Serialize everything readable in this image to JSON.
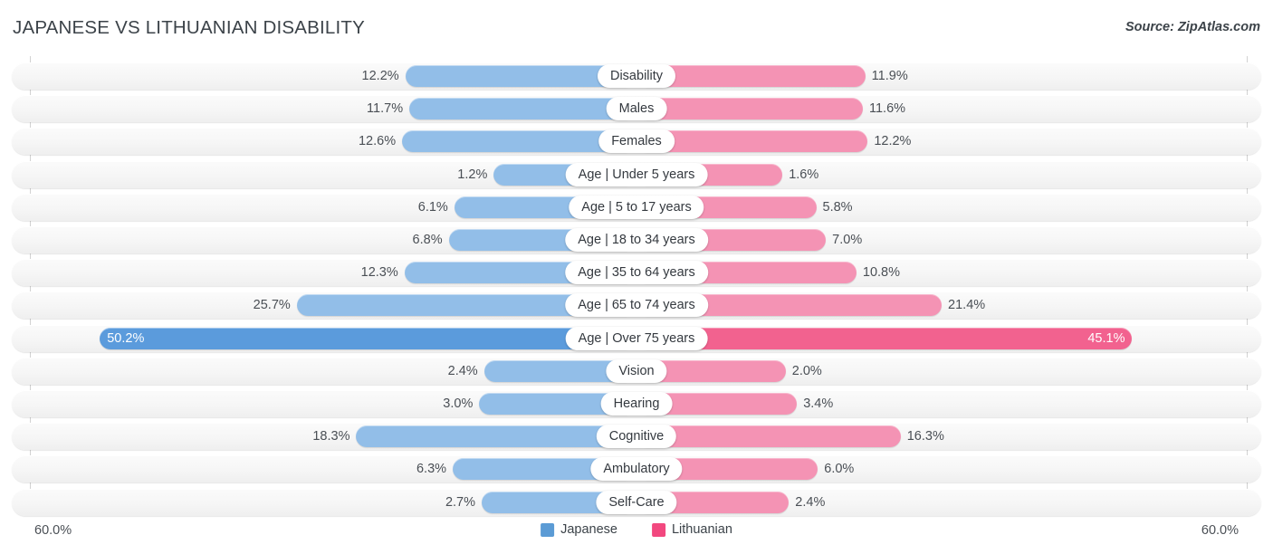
{
  "header": {
    "title": "JAPANESE VS LITHUANIAN DISABILITY",
    "source": "Source: ZipAtlas.com"
  },
  "axis": {
    "left_label": "60.0%",
    "right_label": "60.0%",
    "max": 60.0
  },
  "legend": {
    "items": [
      {
        "label": "Japanese",
        "color": "#5b9bd5"
      },
      {
        "label": "Lithuanian",
        "color": "#f2487f"
      }
    ]
  },
  "colors": {
    "left_bar": "#92bee8",
    "right_bar": "#f493b4",
    "left_bar_highlight": "#5b9bdc",
    "right_bar_highlight": "#f2628f",
    "row_track": "#f6f6f6"
  },
  "chart_data": {
    "type": "bar",
    "title": "JAPANESE VS LITHUANIAN DISABILITY",
    "subtitle": "Source: ZipAtlas.com",
    "orientation": "horizontal-diverging",
    "xlabel": "",
    "ylabel": "",
    "xlim": [
      60.0,
      60.0
    ],
    "grid": false,
    "legend_position": "bottom-center",
    "categories": [
      "Disability",
      "Males",
      "Females",
      "Age | Under 5 years",
      "Age | 5 to 17 years",
      "Age | 18 to 34 years",
      "Age | 35 to 64 years",
      "Age | 65 to 74 years",
      "Age | Over 75 years",
      "Vision",
      "Hearing",
      "Cognitive",
      "Ambulatory",
      "Self-Care"
    ],
    "series": [
      {
        "name": "Japanese",
        "color": "#5b9bd5",
        "values": [
          12.2,
          11.7,
          12.6,
          1.2,
          6.1,
          6.8,
          12.3,
          25.7,
          50.2,
          2.4,
          3.0,
          18.3,
          6.3,
          2.7
        ],
        "labels": [
          "12.2%",
          "11.7%",
          "12.6%",
          "1.2%",
          "6.1%",
          "6.8%",
          "12.3%",
          "25.7%",
          "50.2%",
          "2.4%",
          "3.0%",
          "18.3%",
          "6.3%",
          "2.7%"
        ]
      },
      {
        "name": "Lithuanian",
        "color": "#f2487f",
        "values": [
          11.9,
          11.6,
          12.2,
          1.6,
          5.8,
          7.0,
          10.8,
          21.4,
          45.1,
          2.0,
          3.4,
          16.3,
          6.0,
          2.4
        ],
        "labels": [
          "11.9%",
          "11.6%",
          "12.2%",
          "1.6%",
          "5.8%",
          "7.0%",
          "10.8%",
          "21.4%",
          "45.1%",
          "2.0%",
          "3.4%",
          "16.3%",
          "6.0%",
          "2.4%"
        ]
      }
    ],
    "highlighted_row_index": 8
  }
}
